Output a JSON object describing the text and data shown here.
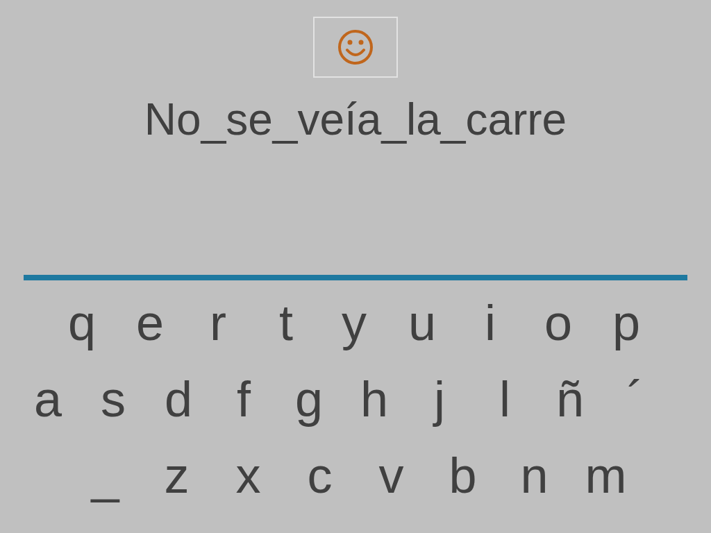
{
  "sentence": "No_se_veía_la_carre",
  "keyboard": {
    "rows": [
      {
        "keys": [
          "q",
          "e",
          "r",
          "t",
          "y",
          "u",
          "i",
          "o",
          "p"
        ]
      },
      {
        "keys": [
          "a",
          "s",
          "d",
          "f",
          "g",
          "h",
          "j",
          "l",
          "ñ",
          "´"
        ]
      },
      {
        "keys": [
          "_",
          "z",
          "x",
          "c",
          "v",
          "b",
          "n",
          "m"
        ]
      }
    ]
  }
}
